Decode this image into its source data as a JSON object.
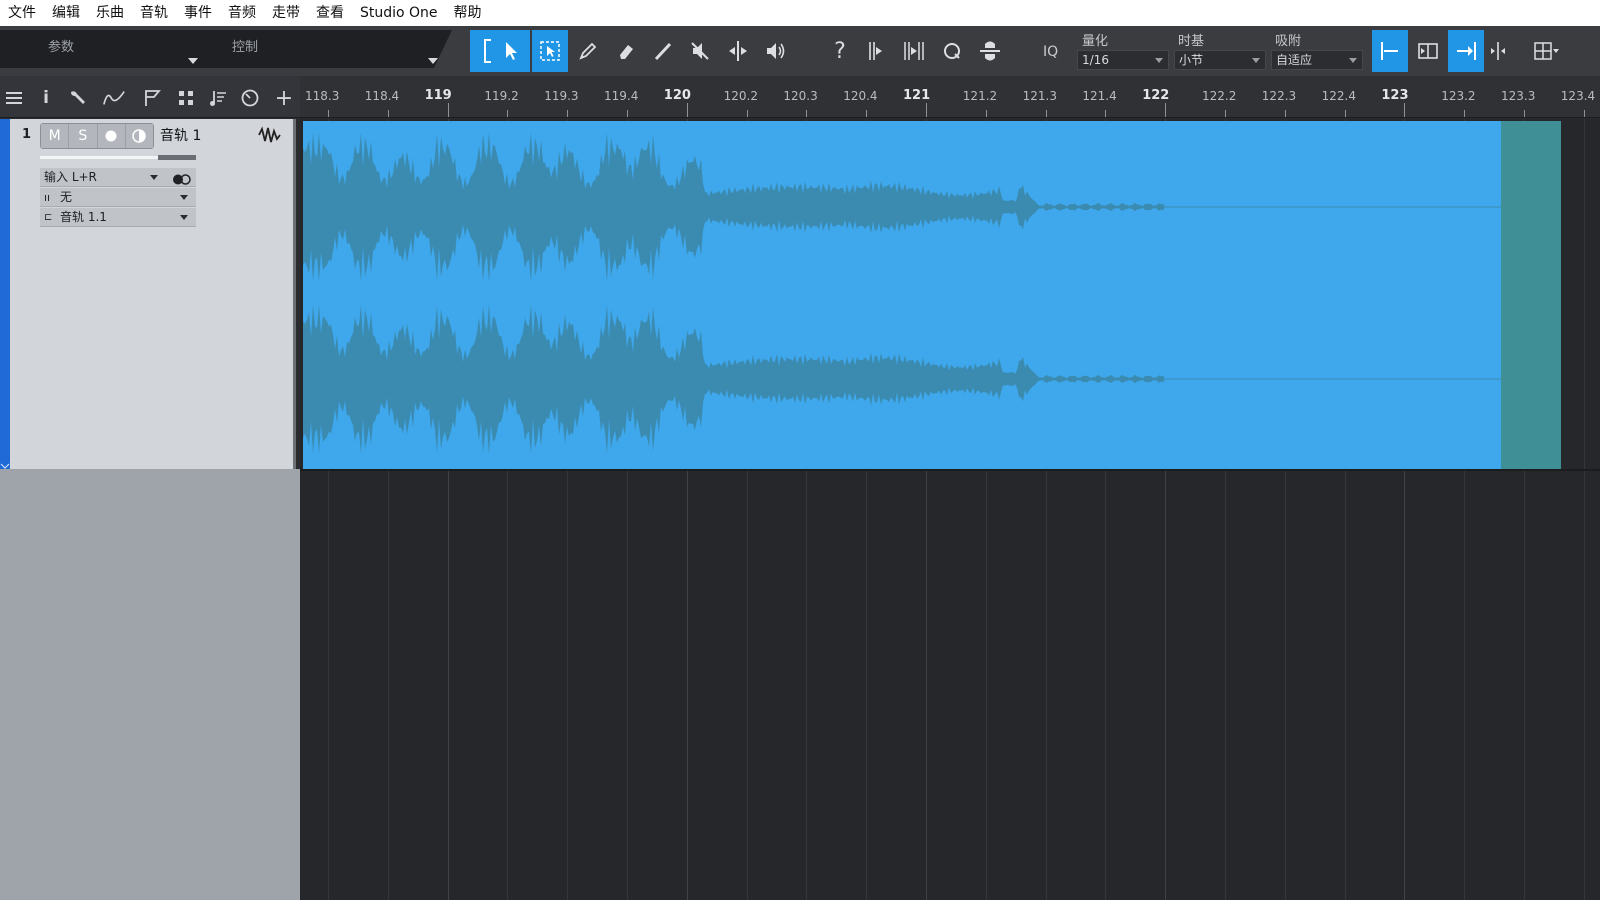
{
  "menu": {
    "items": [
      "文件",
      "编辑",
      "乐曲",
      "音轨",
      "事件",
      "音频",
      "走带",
      "查看",
      "Studio One",
      "帮助"
    ]
  },
  "toolbar": {
    "tab_params": "参数",
    "tab_control": "控制",
    "iq_label": "IQ",
    "quantize_label": "量化",
    "quantize_value": "1/16",
    "timebase_label": "时基",
    "timebase_value": "小节",
    "snap_label": "吸附",
    "snap_value": "自适应",
    "tools": [
      "range-bracket-icon",
      "arrow-pointer-icon",
      "range-select-icon",
      "pencil-icon",
      "eraser-icon",
      "paint-icon",
      "mute-icon",
      "split-icon",
      "speaker-icon",
      "question-icon",
      "bend-icon",
      "transient-icon",
      "quantize-q-icon",
      "listen-icon"
    ],
    "active_tools": [
      "range-bracket-icon",
      "arrow-pointer-icon",
      "range-select-icon"
    ]
  },
  "subbar": {
    "icons": [
      "list-icon",
      "info-icon",
      "wrench-icon",
      "automation-curve-icon",
      "flag-icon",
      "grid-icon",
      "note-icon",
      "clock-icon",
      "add-icon"
    ]
  },
  "ruler": {
    "marks": [
      {
        "label": "118.3",
        "major": false
      },
      {
        "label": "118.4",
        "major": false
      },
      {
        "label": "119",
        "major": true
      },
      {
        "label": "119.2",
        "major": false
      },
      {
        "label": "119.3",
        "major": false
      },
      {
        "label": "119.4",
        "major": false
      },
      {
        "label": "120",
        "major": true
      },
      {
        "label": "120.2",
        "major": false
      },
      {
        "label": "120.3",
        "major": false
      },
      {
        "label": "120.4",
        "major": false
      },
      {
        "label": "121",
        "major": true
      },
      {
        "label": "121.2",
        "major": false
      },
      {
        "label": "121.3",
        "major": false
      },
      {
        "label": "121.4",
        "major": false
      },
      {
        "label": "122",
        "major": true
      },
      {
        "label": "122.2",
        "major": false
      },
      {
        "label": "122.3",
        "major": false
      },
      {
        "label": "122.4",
        "major": false
      },
      {
        "label": "123",
        "major": true
      },
      {
        "label": "123.2",
        "major": false
      },
      {
        "label": "123.3",
        "major": false
      },
      {
        "label": "123.4",
        "major": false
      }
    ]
  },
  "track": {
    "number": "1",
    "name": "音轨 1",
    "mute_label": "M",
    "solo_label": "S",
    "input": "输入 L+R",
    "insert": "无",
    "output": "音轨 1.1",
    "color": "#1f6ad6"
  },
  "clip": {
    "color": "#3fa7ec",
    "waveform_color": "#3b8bb0"
  }
}
